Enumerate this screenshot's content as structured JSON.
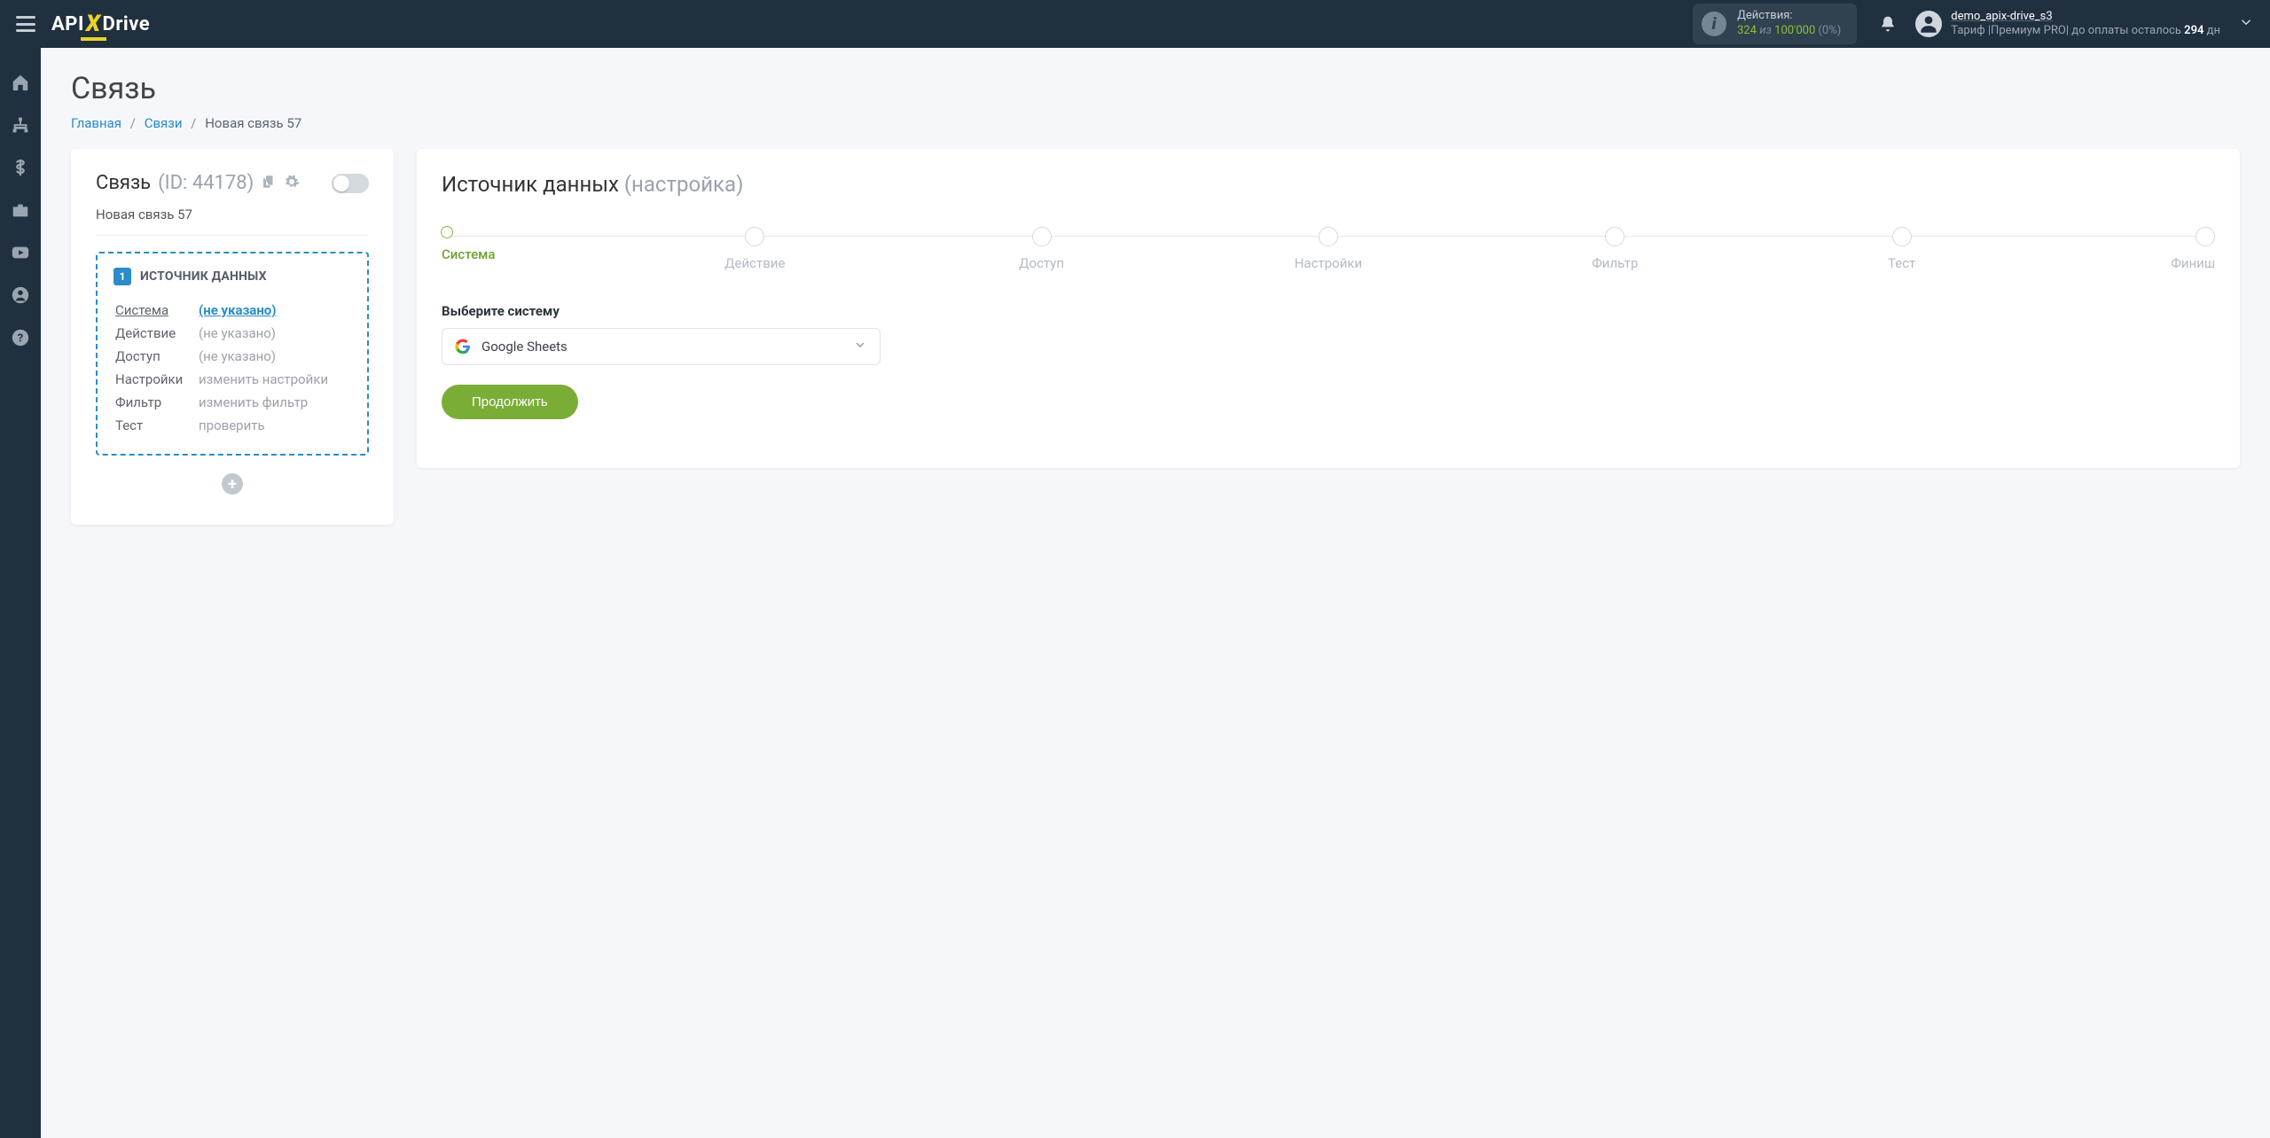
{
  "top": {
    "actions_label": "Действия:",
    "actions_used": "324",
    "actions_of": "из",
    "actions_total": "100'000",
    "actions_pct": "(0%)",
    "user_name": "demo_apix-drive_s3",
    "plan_prefix": "Тариф |Премиум PRO| до оплаты осталось ",
    "plan_days": "294",
    "plan_suffix": " дн"
  },
  "page": {
    "title": "Связь",
    "crumbs": {
      "home": "Главная",
      "links": "Связи",
      "current": "Новая связь 57"
    }
  },
  "left": {
    "title": "Связь",
    "id": "(ID: 44178)",
    "name": "Новая связь 57",
    "source_title": "ИСТОЧНИК ДАННЫХ",
    "rows": {
      "system": "Система",
      "system_val": "(не указано)",
      "action": "Действие",
      "action_val": "(не указано)",
      "access": "Доступ",
      "access_val": "(не указано)",
      "settings": "Настройки",
      "settings_val": "изменить настройки",
      "filter": "Фильтр",
      "filter_val": "изменить фильтр",
      "test": "Тест",
      "test_val": "проверить"
    }
  },
  "right": {
    "title": "Источник данных",
    "subtitle": "(настройка)",
    "steps": [
      "Система",
      "Действие",
      "Доступ",
      "Настройки",
      "Фильтр",
      "Тест",
      "Финиш"
    ],
    "field_label": "Выберите систему",
    "selected_system": "Google Sheets",
    "continue": "Продолжить"
  }
}
